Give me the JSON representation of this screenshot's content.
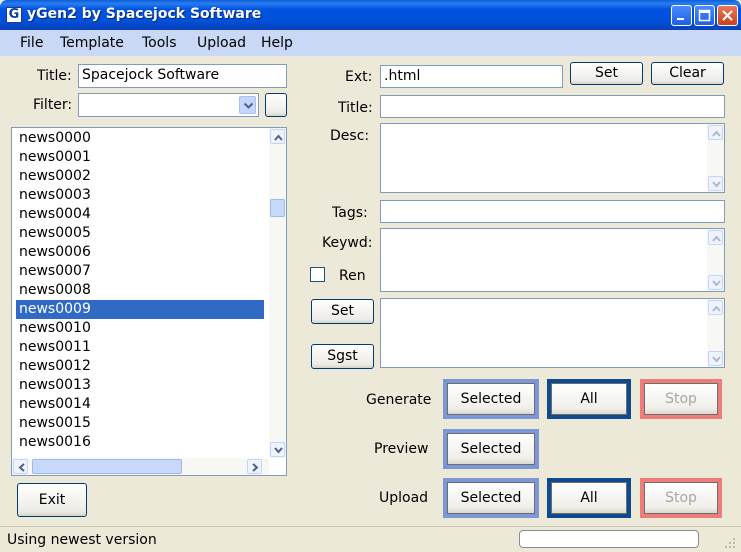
{
  "window": {
    "app_icon_letter": "G",
    "title": "yGen2 by Spacejock Software"
  },
  "menu": [
    "File",
    "Template",
    "Tools",
    "Upload",
    "Help"
  ],
  "left": {
    "title_label": "Title:",
    "title_value": "Spacejock Software",
    "filter_label": "Filter:",
    "filter_value": "",
    "list_items": [
      "news0000",
      "news0001",
      "news0002",
      "news0003",
      "news0004",
      "news0005",
      "news0006",
      "news0007",
      "news0008",
      "news0009",
      "news0010",
      "news0011",
      "news0012",
      "news0013",
      "news0014",
      "news0015",
      "news0016"
    ],
    "selected_item": "news0009",
    "exit_label": "Exit"
  },
  "right": {
    "ext_label": "Ext:",
    "ext_value": ".html",
    "set_label": "Set",
    "clear_label": "Clear",
    "title_label": "Title:",
    "title_value": "",
    "desc_label": "Desc:",
    "tags_label": "Tags:",
    "tags_value": "",
    "keywd_label": "Keywd:",
    "ren_label": "Ren",
    "ren_checked": false,
    "set2_label": "Set",
    "sgst_label": "Sgst"
  },
  "actions": {
    "generate_label": "Generate",
    "preview_label": "Preview",
    "upload_label": "Upload",
    "selected_label": "Selected",
    "all_label": "All",
    "stop_label": "Stop"
  },
  "status": {
    "text": "Using newest version"
  },
  "colors": {
    "titlebar": "#0054e3",
    "menubar": "#c9d8f5",
    "selection": "#316ac5",
    "frame_light": "#7b97d8",
    "frame_dark": "#0d4b8e",
    "frame_red": "#ec7d7b"
  }
}
